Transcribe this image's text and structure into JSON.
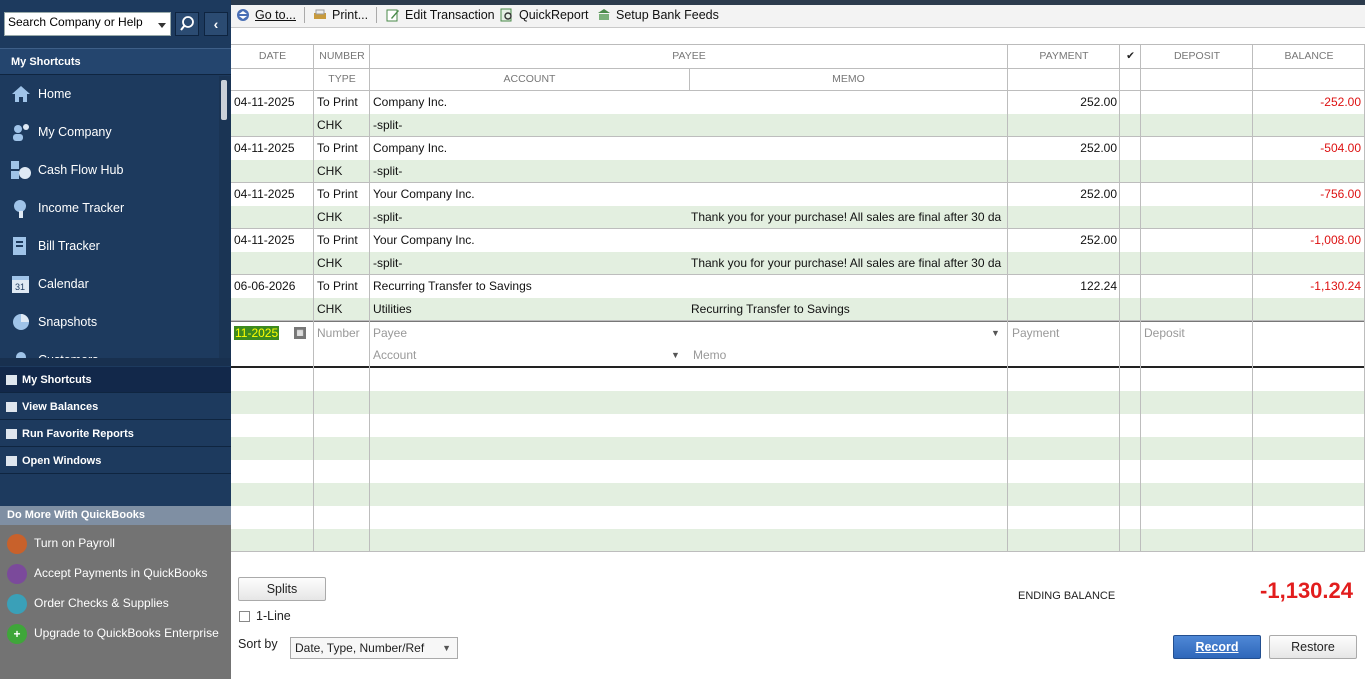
{
  "search": {
    "placeholder": "Search Company or Help"
  },
  "sidebar": {
    "shortcuts_title": "My Shortcuts",
    "items": [
      {
        "label": "Home",
        "icon": "home-icon"
      },
      {
        "label": "My Company",
        "icon": "company-icon"
      },
      {
        "label": "Cash Flow Hub",
        "icon": "cash-flow-icon"
      },
      {
        "label": "Income Tracker",
        "icon": "income-icon"
      },
      {
        "label": "Bill Tracker",
        "icon": "bill-icon"
      },
      {
        "label": "Calendar",
        "icon": "calendar-icon"
      },
      {
        "label": "Snapshots",
        "icon": "pie-chart-icon"
      },
      {
        "label": "Customers",
        "icon": "customer-icon"
      }
    ],
    "bottom_nav": [
      {
        "label": "My Shortcuts"
      },
      {
        "label": "View Balances"
      },
      {
        "label": "Run Favorite Reports"
      },
      {
        "label": "Open Windows"
      }
    ],
    "do_more_title": "Do More With QuickBooks",
    "do_more": [
      {
        "label": "Turn on Payroll",
        "color": "#c8612b"
      },
      {
        "label": "Accept Payments in QuickBooks",
        "color": "#7b4a9b"
      },
      {
        "label": "Order Checks & Supplies",
        "color": "#3aa0b8"
      },
      {
        "label": "Upgrade to QuickBooks Enterprise",
        "color": "#3fa63a"
      }
    ]
  },
  "toolbar": {
    "goto": "Go to...",
    "print": "Print...",
    "edit": "Edit Transaction",
    "quickreport": "QuickReport",
    "bankfeeds": "Setup Bank Feeds"
  },
  "columns": {
    "date": "DATE",
    "number": "NUMBER",
    "type": "TYPE",
    "payee": "PAYEE",
    "account": "ACCOUNT",
    "memo": "MEMO",
    "payment": "PAYMENT",
    "check": "✔",
    "deposit": "DEPOSIT",
    "balance": "BALANCE"
  },
  "transactions": [
    {
      "date": "04-11-2025",
      "number": "To Print",
      "payee": "Company Inc.",
      "payment": "252.00",
      "balance": "-252.00",
      "type": "CHK",
      "account": "-split-",
      "memo": ""
    },
    {
      "date": "04-11-2025",
      "number": "To Print",
      "payee": "Company Inc.",
      "payment": "252.00",
      "balance": "-504.00",
      "type": "CHK",
      "account": "-split-",
      "memo": ""
    },
    {
      "date": "04-11-2025",
      "number": "To Print",
      "payee": "Your Company Inc.",
      "payment": "252.00",
      "balance": "-756.00",
      "type": "CHK",
      "account": "-split-",
      "memo": "Thank you for your purchase! All sales are final after 30 da"
    },
    {
      "date": "04-11-2025",
      "number": "To Print",
      "payee": "Your Company Inc.",
      "payment": "252.00",
      "balance": "-1,008.00",
      "type": "CHK",
      "account": "-split-",
      "memo": "Thank you for your purchase! All sales are final after 30 da"
    },
    {
      "date": "06-06-2026",
      "number": "To Print",
      "payee": "Recurring Transfer to Savings",
      "payment": "122.24",
      "balance": "-1,130.24",
      "type": "CHK",
      "account": "Utilities",
      "memo": "Recurring Transfer to Savings"
    }
  ],
  "entry": {
    "date": "11-2025",
    "number_ph": "Number",
    "payee_ph": "Payee",
    "payment_ph": "Payment",
    "deposit_ph": "Deposit",
    "account_ph": "Account",
    "memo_ph": "Memo"
  },
  "footer": {
    "splits": "Splits",
    "one_line": "1-Line",
    "sort_by": "Sort by",
    "sort_value": "Date, Type, Number/Ref",
    "ending_balance_label": "ENDING BALANCE",
    "ending_balance": "-1,130.24",
    "record": "Record",
    "restore": "Restore"
  },
  "colors": {
    "negative": "#d11111",
    "sidebar": "#1d3a5e",
    "row_green": "#e3efe0"
  }
}
